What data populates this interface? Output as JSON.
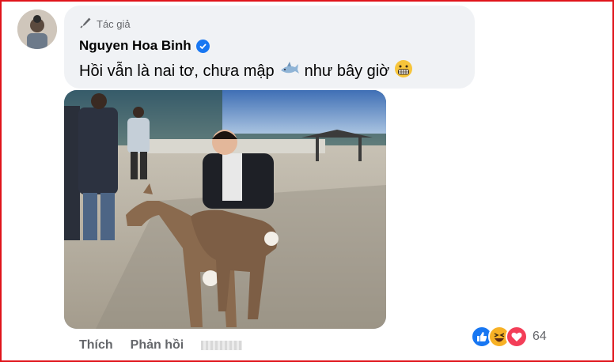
{
  "comment": {
    "author_tag": "Tác giả",
    "author_name": "Nguyen Hoa Binh",
    "text_part1": "Hồi vẫn là nai tơ, chưa mập",
    "text_part2": "như bây giờ",
    "emoji_1": "shark-emoji",
    "emoji_2": "grimacing-face-emoji",
    "verified": true
  },
  "actions": {
    "like_label": "Thích",
    "reply_label": "Phản hồi"
  },
  "reactions": {
    "icons": [
      "like-reaction-icon",
      "haha-reaction-icon",
      "love-reaction-icon"
    ],
    "count": "64"
  },
  "colors": {
    "frame": "#e0141b",
    "bubble": "#f0f2f5",
    "verified": "#1877f2",
    "meta_text": "#65676b"
  }
}
